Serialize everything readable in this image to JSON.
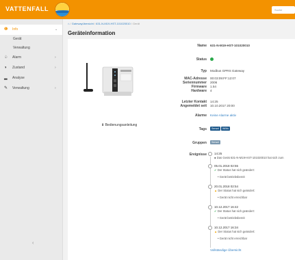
{
  "header": {
    "brand": "VATTENFALL",
    "search_placeholder": "Suche"
  },
  "sidebar": {
    "items": [
      {
        "label": "Info",
        "icon": "info-icon"
      },
      {
        "label": "Alarm",
        "icon": "bell-icon"
      },
      {
        "label": "Zustand",
        "icon": "half-circle-icon"
      },
      {
        "label": "Analyse",
        "icon": "bar-chart-icon"
      },
      {
        "label": "Verwaltung",
        "icon": "wrench-icon"
      }
    ],
    "sub_items": [
      "Gerät",
      "Verwaltung"
    ]
  },
  "breadcrumb": {
    "home_icon": "home-icon",
    "items": [
      "Gatewayübersicht",
      "631-N-M19-HST-101020010",
      "Gerät"
    ]
  },
  "page": {
    "title": "Geräteinformation"
  },
  "manual": {
    "label": "Bedienungsanleitung"
  },
  "details": {
    "name_label": "Name",
    "name": "631-N-M19-HST-101020010",
    "status_label": "Status",
    "status_color": "#2aa84a",
    "typ_label": "Typ",
    "typ": "Modbus GPRS Gateway",
    "mac_label": "MAC-Adresse",
    "mac": "00:03:09:FF:12:07",
    "serial_label": "Seriennummer",
    "serial": "2006",
    "firmware_label": "Firmware",
    "firmware": "1.54",
    "hardware_label": "Hardware",
    "hardware": "4",
    "contact_label": "Letzter Kontakt",
    "contact": "14:25",
    "registered_label": "Angemeldet seit",
    "registered": "10.10.2017 20:00",
    "alarms_label": "Alarme",
    "alarms": "Keine Alarme aktiv",
    "tags_label": "Tags",
    "tags": [
      "Sensel",
      "WiMo"
    ],
    "groups_label": "Gruppen",
    "groups": [
      "Sensel"
    ],
    "events_label": "Ereignisse"
  },
  "events": [
    {
      "date": "14:25",
      "message": "Das Gerät 631-N-M19-HST-101020010 hat sich zum",
      "sub": ""
    },
    {
      "date": "05.01.2018 02:55",
      "message": "Der Status hat sich geändert:",
      "sub": "Gerät betriebsbereit"
    },
    {
      "date": "20.01.2018 02:54",
      "message": "Der Status hat sich geändert:",
      "sub": "Gerät nicht erreichbar"
    },
    {
      "date": "10.12.2017 16:42",
      "message": "Der Status hat sich geändert:",
      "sub": "Gerät betriebsbereit"
    },
    {
      "date": "10.12.2017 16:34",
      "message": "Der Status hat sich geändert:",
      "sub": "Gerät nicht erreichbar"
    }
  ],
  "more_link": "Vollständige Übersicht"
}
